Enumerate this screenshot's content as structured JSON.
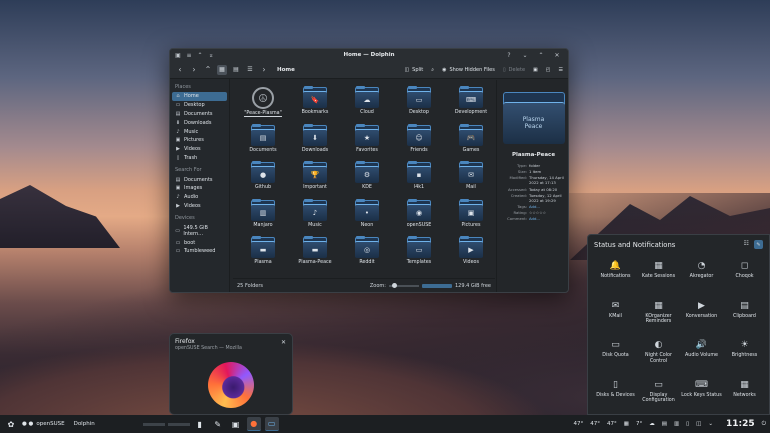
{
  "window": {
    "title": "Home — Dolphin",
    "crumb": "Home",
    "split": "Split",
    "show_hidden": "Show Hidden Files",
    "delete": "Delete"
  },
  "sidebar": {
    "places_header": "Places",
    "places": [
      {
        "label": "Home",
        "icon": "home-icon"
      },
      {
        "label": "Desktop",
        "icon": "desktop-icon"
      },
      {
        "label": "Documents",
        "icon": "documents-icon"
      },
      {
        "label": "Downloads",
        "icon": "downloads-icon"
      },
      {
        "label": "Music",
        "icon": "music-icon"
      },
      {
        "label": "Pictures",
        "icon": "pictures-icon"
      },
      {
        "label": "Videos",
        "icon": "videos-icon"
      },
      {
        "label": "Trash",
        "icon": "trash-icon"
      }
    ],
    "search_header": "Search For",
    "search": [
      {
        "label": "Documents"
      },
      {
        "label": "Images"
      },
      {
        "label": "Audio"
      },
      {
        "label": "Videos"
      }
    ],
    "devices_header": "Devices",
    "devices": [
      {
        "label": "149.5 GiB Intern…"
      },
      {
        "label": "boot"
      },
      {
        "label": "Tumbleweed"
      }
    ]
  },
  "files": [
    {
      "label": "\"Peace-Plasma\"",
      "glyph": "☮",
      "kind": "peace"
    },
    {
      "label": "Bookmarks",
      "glyph": "🔖"
    },
    {
      "label": "Cloud",
      "glyph": "☁"
    },
    {
      "label": "Desktop",
      "glyph": "▭"
    },
    {
      "label": "Development",
      "glyph": "⌨"
    },
    {
      "label": "Documents",
      "glyph": "▤"
    },
    {
      "label": "Downloads",
      "glyph": "⬇"
    },
    {
      "label": "Favorites",
      "glyph": "★"
    },
    {
      "label": "Friends",
      "glyph": "☺"
    },
    {
      "label": "Games",
      "glyph": "🎮"
    },
    {
      "label": "Github",
      "glyph": "●"
    },
    {
      "label": "Important",
      "glyph": "🏆"
    },
    {
      "label": "KDE",
      "glyph": "⚙"
    },
    {
      "label": "l4k1",
      "glyph": "▪"
    },
    {
      "label": "Mail",
      "glyph": "✉"
    },
    {
      "label": "Manjaro",
      "glyph": "▥"
    },
    {
      "label": "Music",
      "glyph": "♪"
    },
    {
      "label": "Neon",
      "glyph": "•"
    },
    {
      "label": "openSUSE",
      "glyph": "◉"
    },
    {
      "label": "Pictures",
      "glyph": "▣"
    },
    {
      "label": "Plasma",
      "glyph": "▬"
    },
    {
      "label": "Plasma-Peace",
      "glyph": "▬"
    },
    {
      "label": "Reddit",
      "glyph": "◎"
    },
    {
      "label": "Templates",
      "glyph": "▭"
    },
    {
      "label": "Videos",
      "glyph": "▶"
    }
  ],
  "status": {
    "count": "25 Folders",
    "zoom": "Zoom:",
    "free": "129.4 GiB free",
    "used_fraction": 0.85
  },
  "info": {
    "name": "Plasma-Peace",
    "folder_text": "Plasma\nPeace",
    "rows": [
      {
        "k": "Type:",
        "v": "folder"
      },
      {
        "k": "Size:",
        "v": "1 item"
      },
      {
        "k": "Modified:",
        "v": "Thursday, 14 April 2022 at 17:13"
      },
      {
        "k": "Accessed:",
        "v": "Today at 08:20"
      },
      {
        "k": "Created:",
        "v": "Tuesday, 12 April 2022 at 19:29"
      },
      {
        "k": "Tags:",
        "v": "Add..."
      },
      {
        "k": "Rating:",
        "v": "☆☆☆☆☆"
      },
      {
        "k": "Comment:",
        "v": "Add..."
      }
    ]
  },
  "firefox": {
    "title": "Firefox",
    "subtitle": "openSUSE Search — Mozilla"
  },
  "panel": {
    "title": "Status and Notifications",
    "items": [
      {
        "label": "Notifications",
        "icon": "🔔"
      },
      {
        "label": "Kate Sessions",
        "icon": "▦"
      },
      {
        "label": "Akregator",
        "icon": "◔"
      },
      {
        "label": "Choqok",
        "icon": "◻"
      },
      {
        "label": "KMail",
        "icon": "✉"
      },
      {
        "label": "KOrganizer Reminders",
        "icon": "▦"
      },
      {
        "label": "Konversation",
        "icon": "▶"
      },
      {
        "label": "Clipboard",
        "icon": "▤"
      },
      {
        "label": "Disk Quota",
        "icon": "▭"
      },
      {
        "label": "Night Color Control",
        "icon": "◐"
      },
      {
        "label": "Audio Volume",
        "icon": "🔊"
      },
      {
        "label": "Brightness",
        "icon": "☀"
      },
      {
        "label": "Disks & Devices",
        "icon": "▯"
      },
      {
        "label": "Display Configuration",
        "icon": "▭"
      },
      {
        "label": "Lock Keys Status",
        "icon": "⌨"
      },
      {
        "label": "Networks",
        "icon": "▦"
      }
    ]
  },
  "taskbar": {
    "desktop": "openSUSE",
    "app": "Dolphin",
    "temps": [
      "47°",
      "47°",
      "47°"
    ],
    "weather": "7°",
    "clock": "11:25"
  }
}
